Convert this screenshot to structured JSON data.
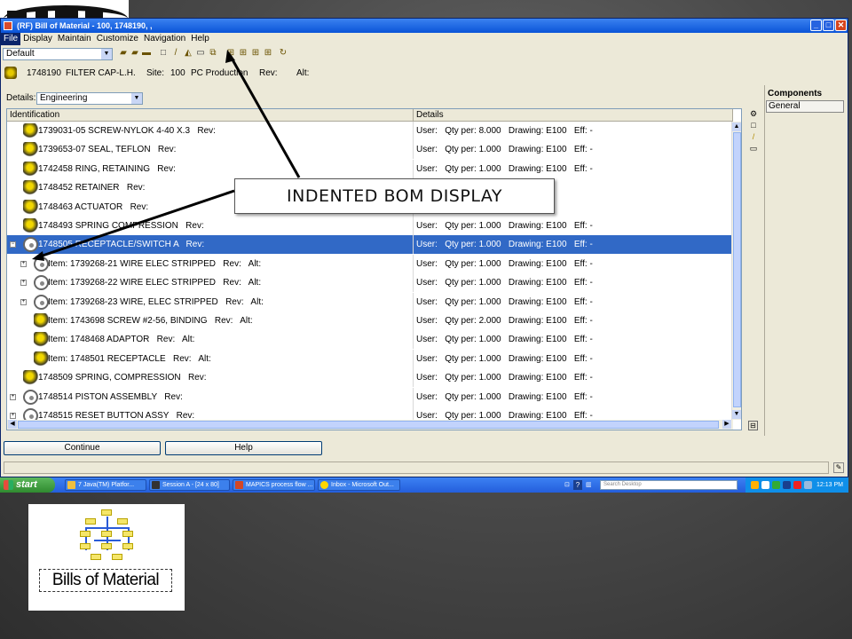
{
  "window": {
    "title": "(RF) Bill of Material - 100, 1748190, ,",
    "min": "_",
    "max": "□",
    "close": "✕"
  },
  "menu": [
    "File",
    "Display",
    "Maintain",
    "Customize",
    "Navigation",
    "Help"
  ],
  "toolbar": {
    "view_combo": "Default"
  },
  "item": {
    "number": "1748190",
    "description": "FILTER CAP-L.H.",
    "site_label": "Site:",
    "site": "100",
    "site_name": "PC Production",
    "rev_label": "Rev:",
    "alt_label": "Alt:"
  },
  "details_select": {
    "label": "Details:",
    "value": "Engineering"
  },
  "columns": {
    "identification": "Identification",
    "details": "Details"
  },
  "rows": [
    {
      "type": "part",
      "level": 1,
      "ident": "1739031-05 SCREW-NYLOK 4-40 X.3   Rev:",
      "details": "User:   Qty per: 8.000   Drawing: E100   Eff: -"
    },
    {
      "type": "part",
      "level": 1,
      "ident": "1739653-07 SEAL, TEFLON   Rev:",
      "details": "User:   Qty per: 1.000   Drawing: E100   Eff: -"
    },
    {
      "type": "part",
      "level": 1,
      "ident": "1742458 RING, RETAINING   Rev:",
      "details": "User:   Qty per: 1.000   Drawing: E100   Eff: -"
    },
    {
      "type": "part",
      "level": 1,
      "ident": "1748452 RETAINER   Rev:",
      "details": "Eff: -"
    },
    {
      "type": "part",
      "level": 1,
      "ident": "1748463 ACTUATOR   Rev:",
      "details": "Eff: -"
    },
    {
      "type": "part",
      "level": 1,
      "ident": "1748493 SPRING COMPRESSION   Rev:",
      "details": "User:   Qty per: 1.000   Drawing: E100   Eff: -"
    },
    {
      "type": "assy",
      "level": 1,
      "expander": "−",
      "selected": true,
      "ident": "1748505 RECEPTACLE/SWITCH A   Rev:",
      "details": "User:   Qty per: 1.000   Drawing: E100   Eff: -"
    },
    {
      "type": "assy",
      "level": 2,
      "expander": "+",
      "ident": "Item: 1739268-21 WIRE ELEC STRIPPED   Rev:   Alt:",
      "details": "User:   Qty per: 1.000   Drawing: E100   Eff: -"
    },
    {
      "type": "assy",
      "level": 2,
      "expander": "+",
      "ident": "Item: 1739268-22 WIRE ELEC STRIPPED   Rev:   Alt:",
      "details": "User:   Qty per: 1.000   Drawing: E100   Eff: -"
    },
    {
      "type": "assy",
      "level": 2,
      "expander": "+",
      "ident": "Item: 1739268-23 WIRE, ELEC STRIPPED   Rev:   Alt:",
      "details": "User:   Qty per: 1.000   Drawing: E100   Eff: -"
    },
    {
      "type": "part",
      "level": 2,
      "ident": "Item: 1743698 SCREW #2-56, BINDING   Rev:   Alt:",
      "details": "User:   Qty per: 2.000   Drawing: E100   Eff: -"
    },
    {
      "type": "part",
      "level": 2,
      "ident": "Item: 1748468 ADAPTOR   Rev:   Alt:",
      "details": "User:   Qty per: 1.000   Drawing: E100   Eff: -"
    },
    {
      "type": "part",
      "level": 2,
      "ident": "Item: 1748501 RECEPTACLE   Rev:   Alt:",
      "details": "User:   Qty per: 1.000   Drawing: E100   Eff: -"
    },
    {
      "type": "part",
      "level": 1,
      "ident": "1748509 SPRING, COMPRESSION   Rev:",
      "details": "User:   Qty per: 1.000   Drawing: E100   Eff: -"
    },
    {
      "type": "assy",
      "level": 1,
      "expander": "+",
      "ident": "1748514 PISTON ASSEMBLY   Rev:",
      "details": "User:   Qty per: 1.000   Drawing: E100   Eff: -"
    },
    {
      "type": "assy",
      "level": 1,
      "expander": "+",
      "ident": "1748515 RESET BUTTON ASSY   Rev:",
      "details": "User:   Qty per: 1.000   Drawing: E100   Eff: -"
    }
  ],
  "side_tabs": {
    "components": "Components",
    "general": "General"
  },
  "buttons": {
    "continue": "Continue",
    "help": "Help"
  },
  "callout": "INDENTED BOM DISPLAY",
  "taskbar": {
    "start": "start",
    "tasks": [
      "7 Java(TM) Platfor...",
      "Session A - [24 x 80]",
      "MAPICS process flow ...",
      "Inbox - Microsoft Out..."
    ],
    "search_placeholder": "Search Desktop",
    "clock": "12:13 PM"
  },
  "logo_caption": "Bills of Material",
  "colors": {
    "selection": "#3169c6",
    "titlebar": "#0a54d8",
    "taskbar": "#245edc",
    "start": "#2f8a2f"
  }
}
